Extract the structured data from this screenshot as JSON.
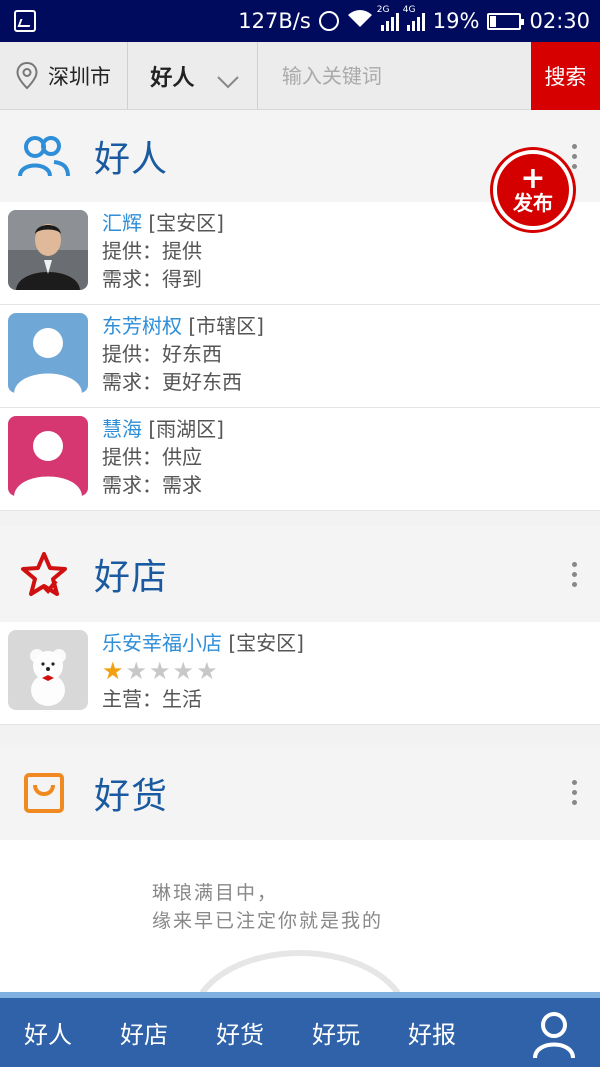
{
  "status_bar": {
    "speed": "127B/s",
    "network_2g": "2G",
    "network_4g": "4G",
    "battery": "19%",
    "battery_level": 0.19,
    "time": "02:30"
  },
  "search_bar": {
    "city": "深圳市",
    "category": "好人",
    "keyword_placeholder": "输入关键词",
    "search_label": "搜索"
  },
  "publish_button": {
    "plus": "+",
    "label": "发布"
  },
  "sections": {
    "people": {
      "title": "好人",
      "items": [
        {
          "name": "汇辉",
          "district": "[宝安区]",
          "offer": "提供：提供",
          "need": "需求：得到"
        },
        {
          "name": "东芳树权",
          "district": "[市辖区]",
          "offer": "提供：好东西",
          "need": "需求：更好东西"
        },
        {
          "name": "慧海",
          "district": "[雨湖区]",
          "offer": "提供：供应",
          "need": "需求：需求"
        }
      ]
    },
    "shops": {
      "title": "好店",
      "items": [
        {
          "name": "乐安幸福小店",
          "district": "[宝安区]",
          "rating": 1,
          "rating_max": 5,
          "business": "主营：生活"
        }
      ]
    },
    "goods": {
      "title": "好货"
    }
  },
  "promo": {
    "line1": "琳琅满目中，",
    "line2": "缘来早已注定你就是我的"
  },
  "bottom_nav": {
    "tabs": [
      "好人",
      "好店",
      "好货",
      "好玩",
      "好报"
    ]
  },
  "colors": {
    "accent_blue": "#1a5aa0",
    "link_blue": "#2f8ed8",
    "search_red": "#d60000",
    "nav_blue": "#2f62a8",
    "star_on": "#f0a010"
  }
}
